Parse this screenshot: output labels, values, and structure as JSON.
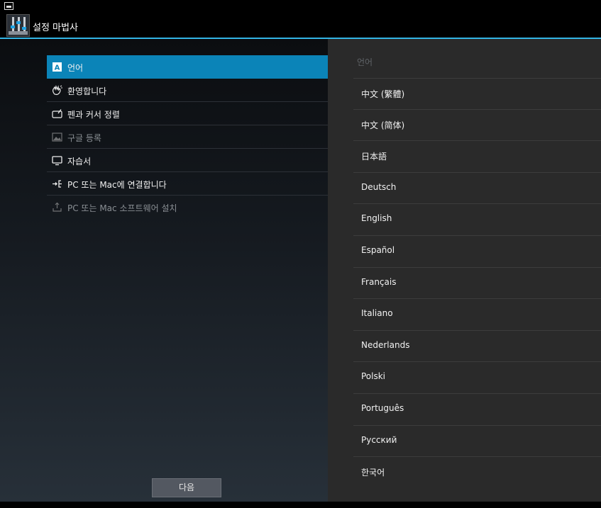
{
  "app": {
    "title": "설정 마법사"
  },
  "menu": {
    "items": [
      {
        "label": "언어",
        "icon": "letter-a-icon",
        "selected": true,
        "disabled": false
      },
      {
        "label": "환영합니다",
        "icon": "waving-hand-icon",
        "selected": false,
        "disabled": false
      },
      {
        "label": "펜과 커서 정렬",
        "icon": "pen-tablet-icon",
        "selected": false,
        "disabled": false
      },
      {
        "label": "구글 등록",
        "icon": "picture-icon",
        "selected": false,
        "disabled": true
      },
      {
        "label": "자습서",
        "icon": "monitor-icon",
        "selected": false,
        "disabled": false
      },
      {
        "label": "PC 또는 Mac에 연결합니다",
        "icon": "usb-connect-icon",
        "selected": false,
        "disabled": false
      },
      {
        "label": "PC 또는 Mac 소프트웨어 설치",
        "icon": "install-icon",
        "selected": false,
        "disabled": true
      }
    ]
  },
  "next_label": "다음",
  "languages": {
    "header": "언어",
    "items": [
      "中文 (繁體)",
      "中文 (简体)",
      "日本語",
      "Deutsch",
      "English",
      "Español",
      "Français",
      "Italiano",
      "Nederlands",
      "Polski",
      "Português",
      "Русский",
      "한국어"
    ]
  },
  "colors": {
    "accent": "#33b5e5",
    "selected_row": "#0b84b8"
  }
}
